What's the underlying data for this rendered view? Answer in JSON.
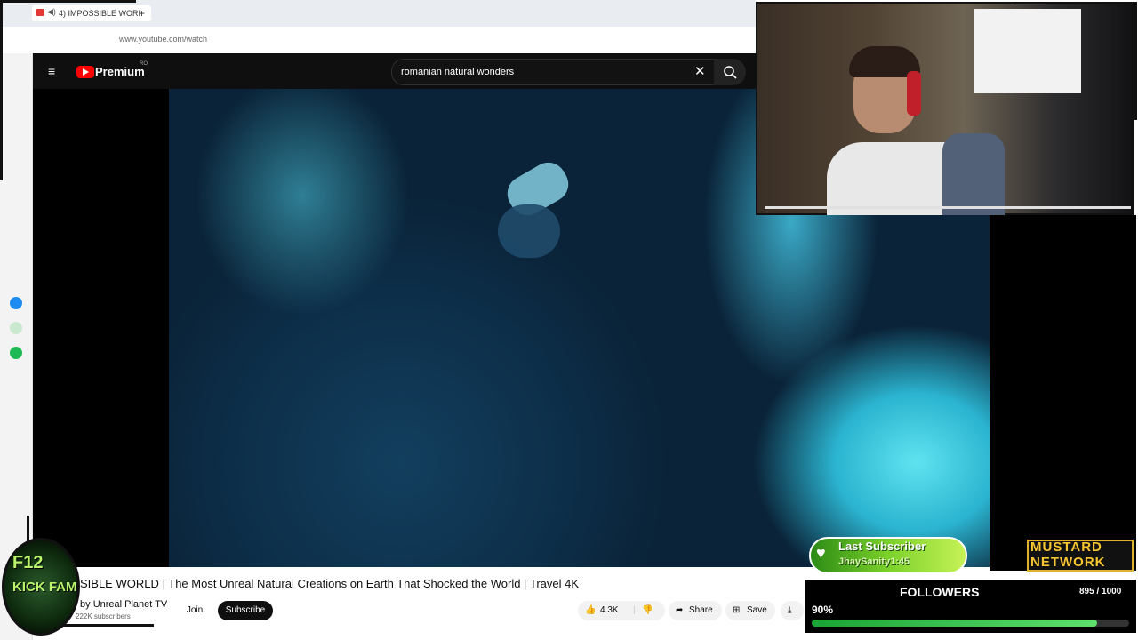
{
  "browser": {
    "tab_title": "4) IMPOSSIBLE WORI",
    "new_tab_symbol": "+",
    "url": "www.youtube.com/watch"
  },
  "youtube": {
    "menu_icon": "hamburger-icon",
    "logo_text": "Premium",
    "region": "RO",
    "search_query": "romanian natural wonders",
    "clear_symbol": "✕",
    "search_icon": "search-icon"
  },
  "video": {
    "title_prefix": "SIBLE WORLD",
    "title": "The Most Unreal Natural Creations on Earth That Shocked the World",
    "title_suffix": "Travel 4K",
    "channel": "Unreal Planet TV",
    "channel_prefix": "by",
    "subscribers": "222K subscribers",
    "join_label": "Join",
    "subscribe_label": "Subscribe",
    "likes": "4.3K",
    "share_label": "Share",
    "save_label": "Save"
  },
  "overlay": {
    "badge_line1": "F12",
    "badge_line2": "KICK FAM",
    "last_subscriber_label": "Last Subscriber",
    "last_subscriber_name": "JhaySanity1:45",
    "network_line1": "MUSTARD",
    "network_line2": "NETWORK",
    "followers_label": "FOLLOWERS",
    "followers_count": "895 / 1000",
    "followers_percent_text": "90%",
    "followers_progress": 0.9
  },
  "colors": {
    "yt_red": "#ff0000",
    "accent_green": "#7bd12a",
    "mustard": "#f7c531"
  }
}
